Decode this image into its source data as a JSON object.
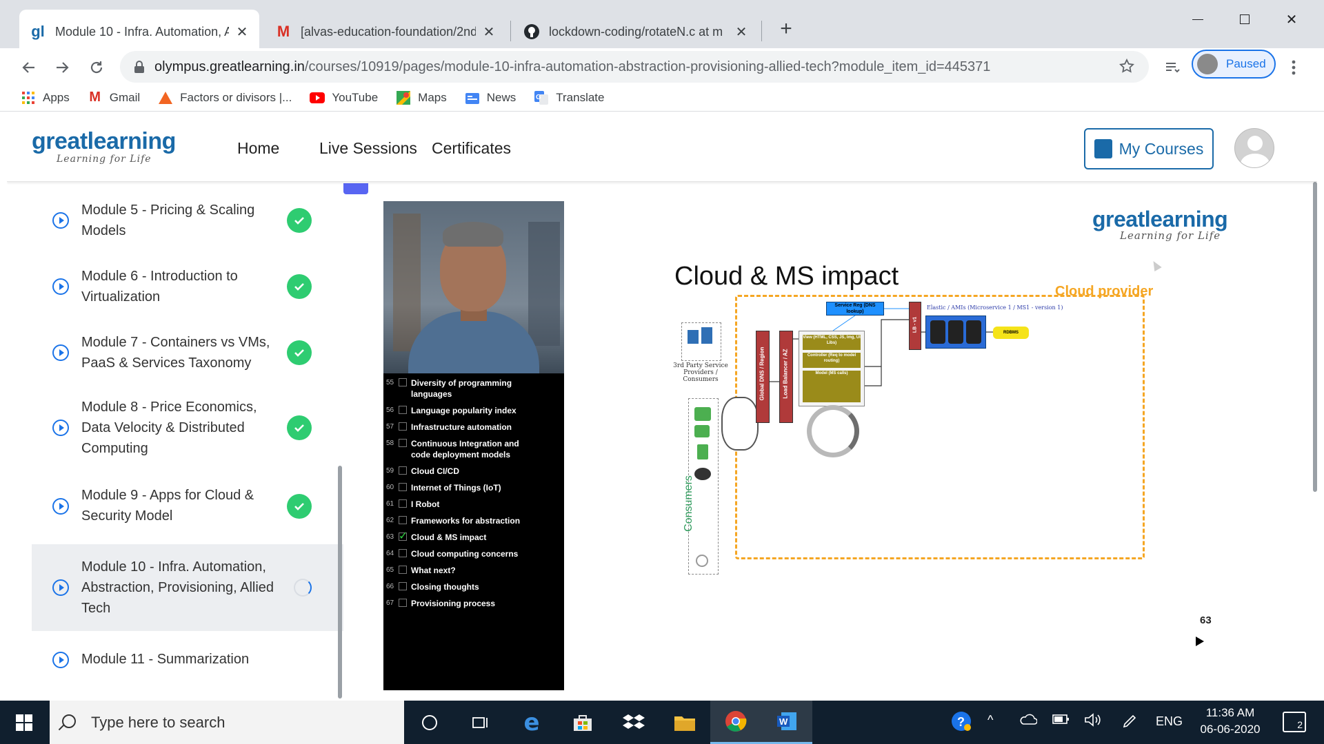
{
  "browser": {
    "tabs": [
      {
        "favicon": "gl",
        "title": "Module 10 - Infra. Automation, A",
        "active": true
      },
      {
        "favicon": "M",
        "title": "[alvas-education-foundation/2nd",
        "active": false
      },
      {
        "favicon": "github-icon",
        "title": "lockdown-coding/rotateN.c at m",
        "active": false
      }
    ],
    "new_tab": "+",
    "url_domain": "olympus.greatlearning.in",
    "url_path": "/courses/10919/pages/module-10-infra-automation-abstraction-provisioning-allied-tech?module_item_id=445371",
    "profile_status": "Paused",
    "bookmarks": [
      {
        "label": "Apps"
      },
      {
        "label": "Gmail"
      },
      {
        "label": "Factors or divisors |..."
      },
      {
        "label": "YouTube"
      },
      {
        "label": "Maps"
      },
      {
        "label": "News"
      },
      {
        "label": "Translate"
      }
    ]
  },
  "site": {
    "logo_brand": "greatlearning",
    "logo_tagline": "Learning for Life",
    "nav": [
      "Home",
      "Live Sessions",
      "Certificates"
    ],
    "my_courses": "My Courses"
  },
  "sidebar": {
    "modules": [
      {
        "title": "Module 5 - Pricing & Scaling Models",
        "status": "completed"
      },
      {
        "title": "Module 6 - Introduction to Virtualization",
        "status": "completed"
      },
      {
        "title": "Module 7 - Containers vs VMs, PaaS & Services Taxonomy",
        "status": "completed"
      },
      {
        "title": "Module 8 - Price Economics, Data Velocity & Distributed Computing",
        "status": "completed"
      },
      {
        "title": "Module 9 - Apps for Cloud & Security Model",
        "status": "completed"
      },
      {
        "title": "Module 10 - Infra. Automation, Abstraction, Provisioning, Allied Tech",
        "status": "in-progress"
      },
      {
        "title": "Module 11 - Summarization",
        "status": "not-started"
      }
    ]
  },
  "slide": {
    "logo_brand": "greatlearning",
    "logo_tagline": "Learning for Life",
    "title": "Cloud & MS impact",
    "cloud_label": "Cloud provider",
    "page_number": "63",
    "agenda": [
      {
        "num": "55",
        "text": "Diversity of programming languages",
        "checked": false
      },
      {
        "num": "56",
        "text": "Language popularity index",
        "checked": false
      },
      {
        "num": "57",
        "text": "Infrastructure automation",
        "checked": false
      },
      {
        "num": "58",
        "text": "Continuous Integration and code deployment models",
        "checked": false
      },
      {
        "num": "59",
        "text": "Cloud CI/CD",
        "checked": false
      },
      {
        "num": "60",
        "text": "Internet of Things (IoT)",
        "checked": false
      },
      {
        "num": "61",
        "text": "I Robot",
        "checked": false
      },
      {
        "num": "62",
        "text": "Frameworks for abstraction",
        "checked": false
      },
      {
        "num": "63",
        "text": "Cloud & MS impact",
        "checked": true
      },
      {
        "num": "64",
        "text": "Cloud computing concerns",
        "checked": false
      },
      {
        "num": "65",
        "text": "What next?",
        "checked": false
      },
      {
        "num": "66",
        "text": "Closing thoughts",
        "checked": false
      },
      {
        "num": "67",
        "text": "Provisioning process",
        "checked": false
      }
    ],
    "diagram": {
      "third_party": "3rd Party Service Providers / Consumers",
      "consumers": "Consumers",
      "global_dns": "Global DNS / Region",
      "load_balancer": "Load Balancer / AZ",
      "service_reg": "Service Reg (DNS lookup)",
      "view": "View (HTML, CSS, JS, Img, UI Libs)",
      "controller": "Controller (Req to model routing)",
      "model": "Model (MS calls)",
      "lb_v1": "LB - v1",
      "elastic": "Elastic / AMIs (Microservice 1 / MS1 - version 1)",
      "rdbms": "RDBMS"
    }
  },
  "taskbar": {
    "search_placeholder": "Type here to search",
    "language": "ENG",
    "time": "11:36 AM",
    "date": "06-06-2020",
    "notifications": "2"
  },
  "colors": {
    "brand": "#1a6aa8",
    "completed": "#2ecc71",
    "accent": "#1a73e8",
    "cloud_box": "#f5a623"
  }
}
